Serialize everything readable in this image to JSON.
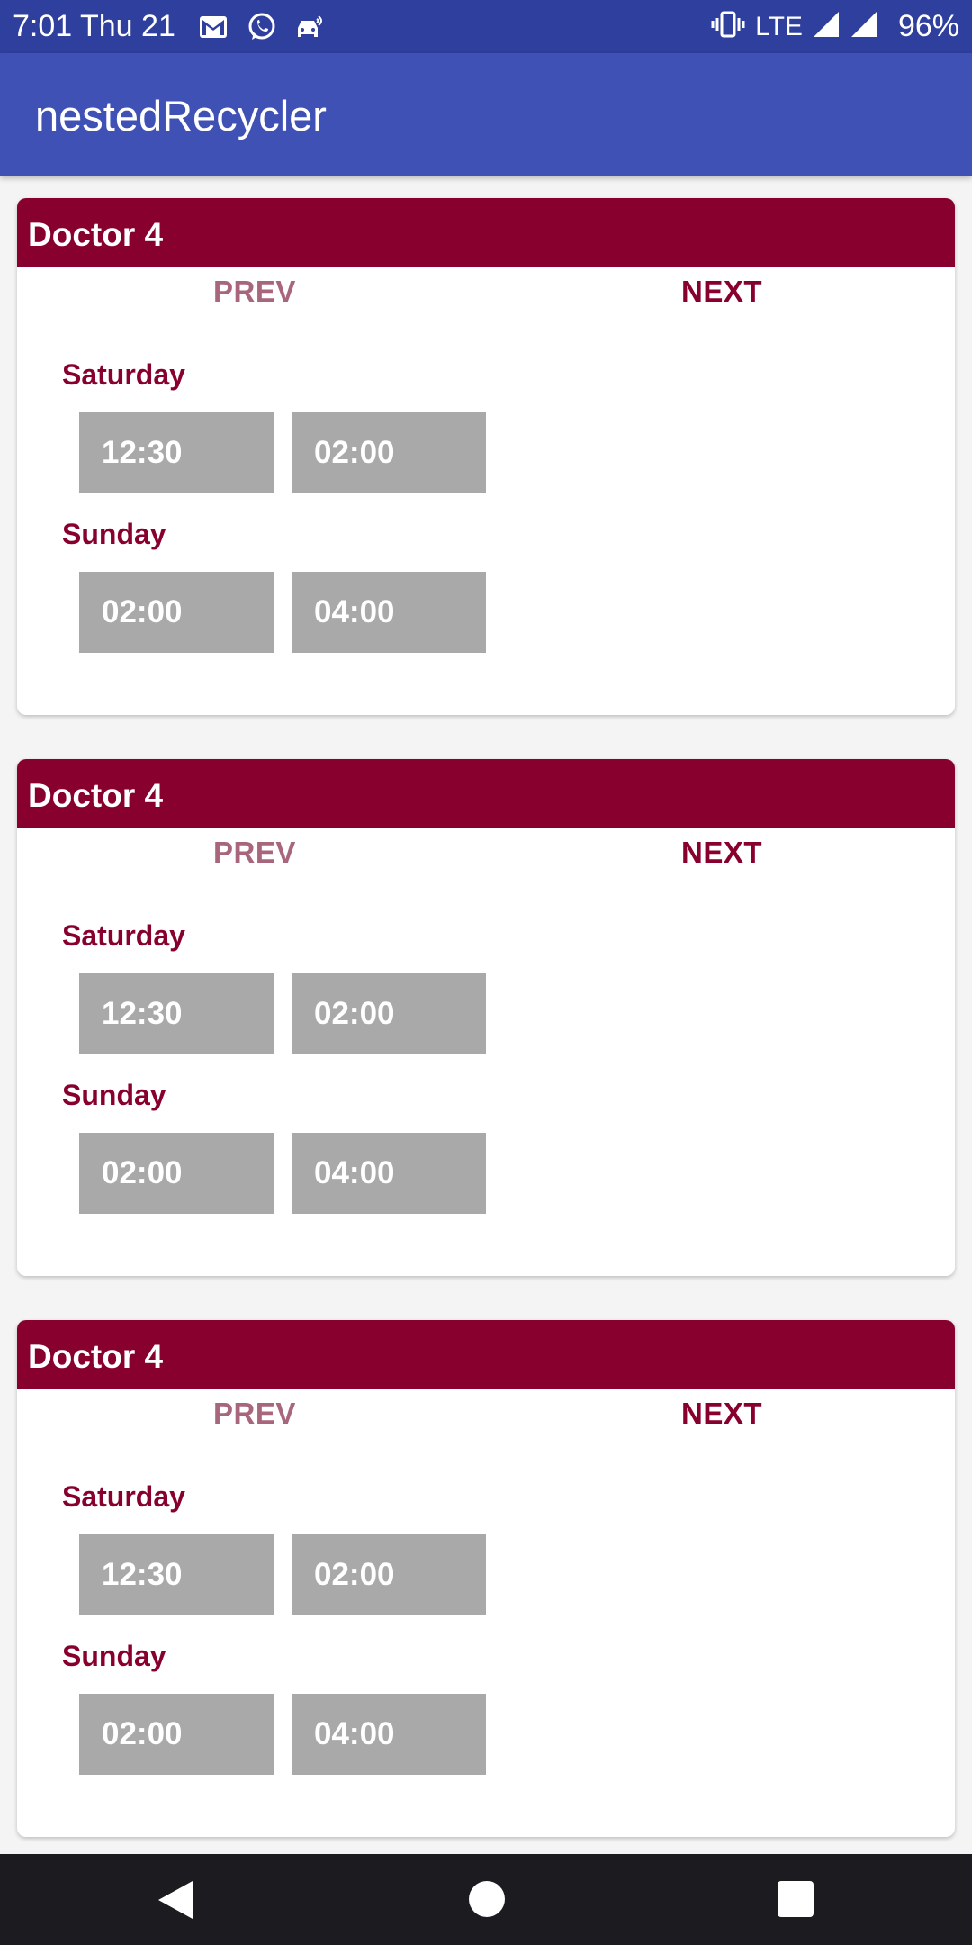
{
  "status_bar": {
    "time": "7:01 Thu 21",
    "network": "LTE",
    "battery": "96%",
    "icons": [
      "gmail-icon",
      "whatsapp-icon",
      "car-icon",
      "vibrate-icon",
      "signal-icon",
      "signal-icon"
    ]
  },
  "app_bar": {
    "title": "nestedRecycler"
  },
  "colors": {
    "status_bar": "#2e3f9e",
    "app_bar": "#3f51b5",
    "card_header": "#87002e",
    "prev": "#a8667b",
    "slot": "#a9a9a9",
    "nav_bar": "#1c1b1f"
  },
  "cards": [
    {
      "title": "Doctor 4",
      "prev": "PREV",
      "next": "NEXT",
      "days": [
        {
          "label": "Saturday",
          "slots": [
            "12:30",
            "02:00"
          ]
        },
        {
          "label": "Sunday",
          "slots": [
            "02:00",
            "04:00"
          ]
        }
      ]
    },
    {
      "title": "Doctor 4",
      "prev": "PREV",
      "next": "NEXT",
      "days": [
        {
          "label": "Saturday",
          "slots": [
            "12:30",
            "02:00"
          ]
        },
        {
          "label": "Sunday",
          "slots": [
            "02:00",
            "04:00"
          ]
        }
      ]
    },
    {
      "title": "Doctor 4",
      "prev": "PREV",
      "next": "NEXT",
      "days": [
        {
          "label": "Saturday",
          "slots": [
            "12:30",
            "02:00"
          ]
        },
        {
          "label": "Sunday",
          "slots": [
            "02:00",
            "04:00"
          ]
        }
      ]
    }
  ],
  "nav_bar": {
    "icons": [
      "back-icon",
      "home-icon",
      "recents-icon"
    ]
  }
}
